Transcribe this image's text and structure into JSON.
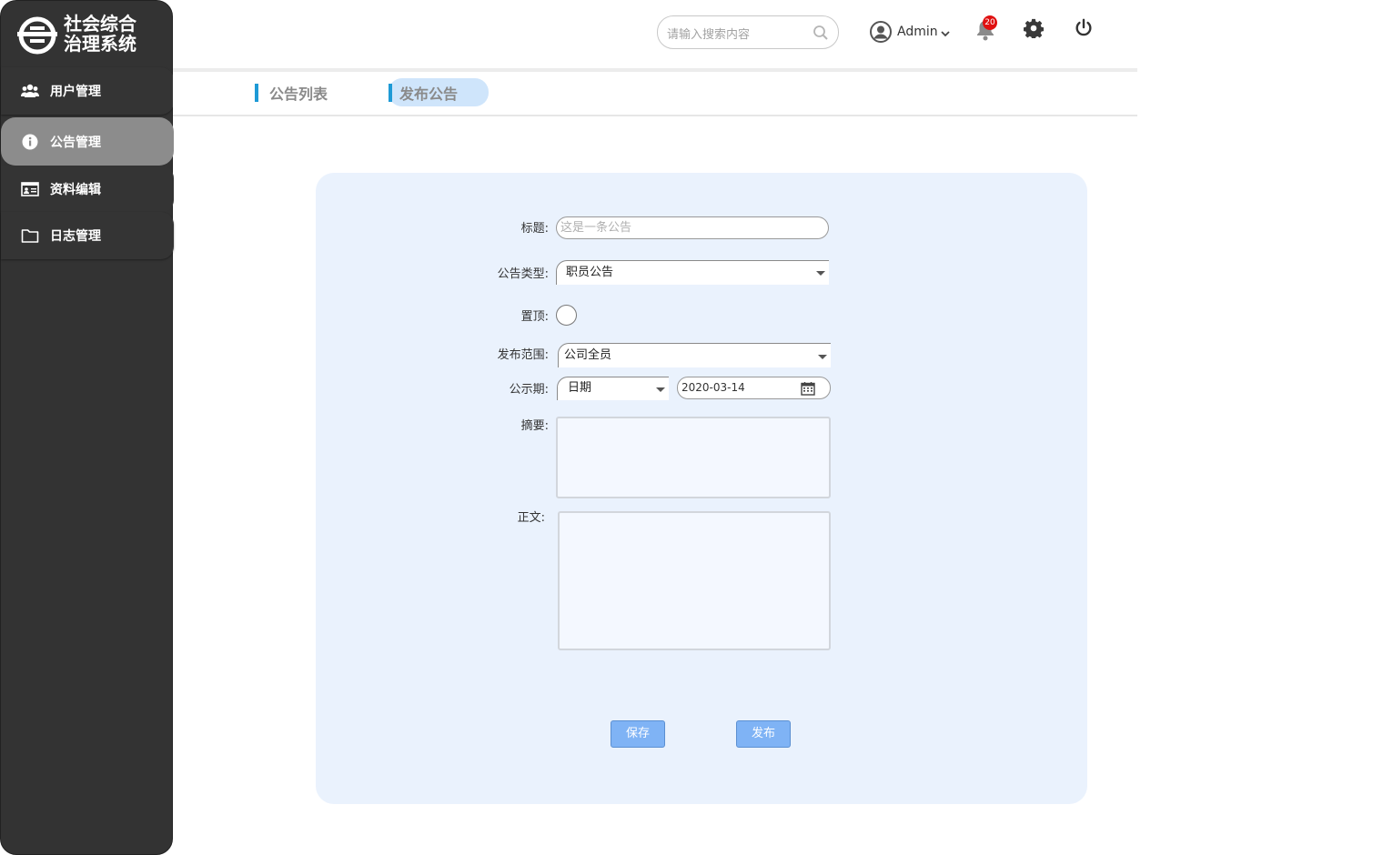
{
  "app": {
    "title_line1": "社会综合",
    "title_line2": "治理系统"
  },
  "sidebar": {
    "items": [
      {
        "label": "用户管理",
        "icon": "users-icon"
      },
      {
        "label": "公告管理",
        "icon": "info-icon",
        "active": true
      },
      {
        "label": "资料编辑",
        "icon": "id-card-icon"
      },
      {
        "label": "日志管理",
        "icon": "folder-icon"
      }
    ]
  },
  "header": {
    "search_placeholder": "请输入搜索内容",
    "user_name": "Admin",
    "notification_count": "20"
  },
  "tabs": [
    {
      "label": "公告列表"
    },
    {
      "label": "发布公告",
      "active": true
    }
  ],
  "form": {
    "title_label": "标题:",
    "title_placeholder": "这是一条公告",
    "type_label": "公告类型:",
    "type_value": "职员公告",
    "pin_label": "置顶:",
    "scope_label": "发布范围:",
    "scope_value": "公司全员",
    "period_label": "公示期:",
    "period_type": "日期",
    "period_date": "2020-03-14",
    "summary_label": "摘要:",
    "body_label": "正文:",
    "save_label": "保存",
    "publish_label": "发布"
  },
  "colors": {
    "sidebar_bg": "#333333",
    "sidebar_active": "#8c8c8c",
    "accent": "#1e9ad6",
    "panel_bg": "#eaf2fd",
    "button_bg": "#7fb3f5",
    "badge": "#e01010"
  }
}
